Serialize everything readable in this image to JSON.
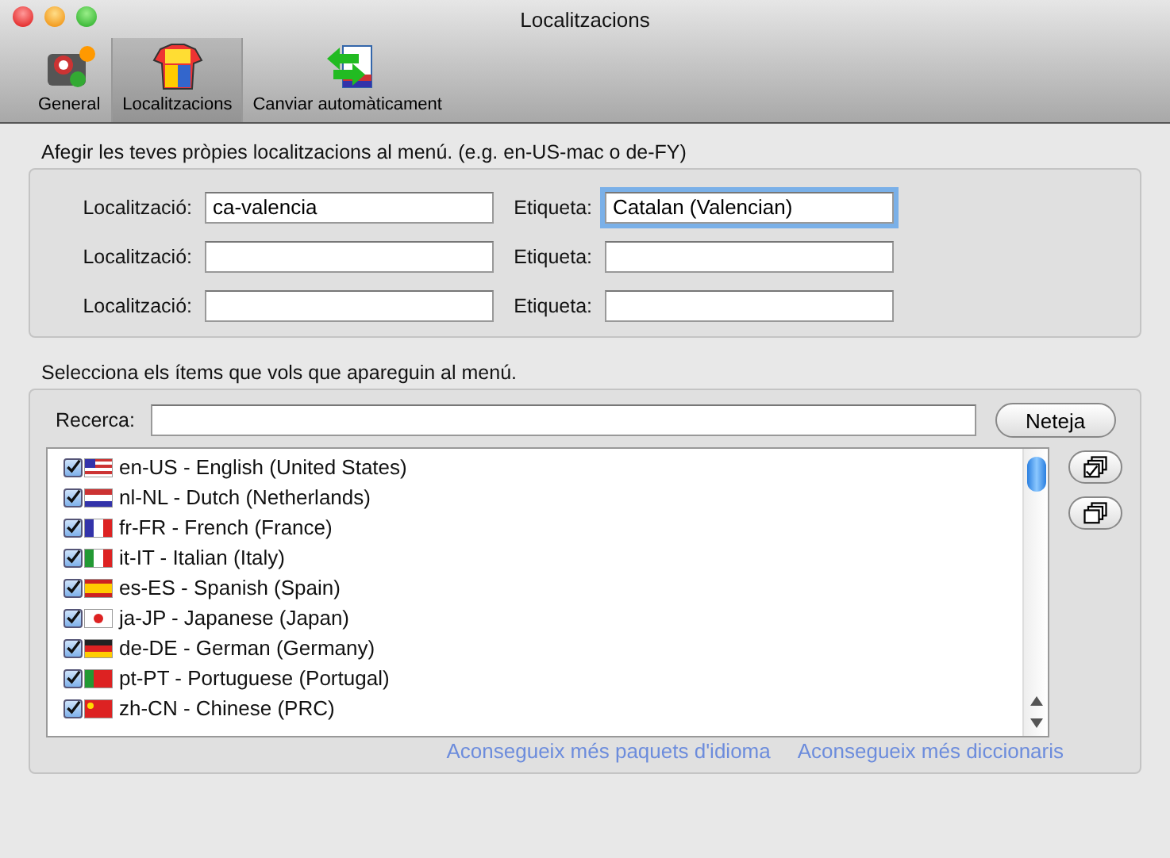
{
  "window": {
    "title": "Localitzacions"
  },
  "toolbar": [
    {
      "label": "General",
      "kind": "general",
      "selected": false
    },
    {
      "label": "Localitzacions",
      "kind": "shirt",
      "selected": true
    },
    {
      "label": "Canviar automàticament",
      "kind": "switch",
      "selected": false
    }
  ],
  "custom_section": {
    "heading": "Afegir les teves pròpies localitzacions al menú. (e.g. en-US-mac o de-FY)",
    "rows": [
      {
        "locale_label": "Localització:",
        "locale_value": "ca-valencia",
        "tag_label": "Etiqueta:",
        "tag_value": "Catalan (Valencian)",
        "tag_focused": true
      },
      {
        "locale_label": "Localització:",
        "locale_value": "",
        "tag_label": "Etiqueta:",
        "tag_value": "",
        "tag_focused": false
      },
      {
        "locale_label": "Localització:",
        "locale_value": "",
        "tag_label": "Etiqueta:",
        "tag_value": "",
        "tag_focused": false
      }
    ]
  },
  "menu_section": {
    "heading": "Selecciona els ítems que vols que apareguin al menú.",
    "search_label": "Recerca:",
    "clear_button": "Neteja",
    "items": [
      {
        "label": "en-US - English (United States)",
        "kind": "us",
        "checked": true
      },
      {
        "label": "nl-NL - Dutch (Netherlands)",
        "kind": "nl",
        "checked": true
      },
      {
        "label": "fr-FR - French (France)",
        "kind": "fr",
        "checked": true
      },
      {
        "label": "it-IT - Italian (Italy)",
        "kind": "it",
        "checked": true
      },
      {
        "label": "es-ES - Spanish (Spain)",
        "kind": "es",
        "checked": true
      },
      {
        "label": "ja-JP - Japanese (Japan)",
        "kind": "jp",
        "checked": true
      },
      {
        "label": "de-DE - German (Germany)",
        "kind": "de",
        "checked": true
      },
      {
        "label": "pt-PT - Portuguese (Portugal)",
        "kind": "pt",
        "checked": true
      },
      {
        "label": "zh-CN - Chinese (PRC)",
        "kind": "cn",
        "checked": true
      }
    ],
    "links": [
      "Aconsegueix més paquets d'idioma",
      "Aconsegueix més diccionaris"
    ]
  }
}
